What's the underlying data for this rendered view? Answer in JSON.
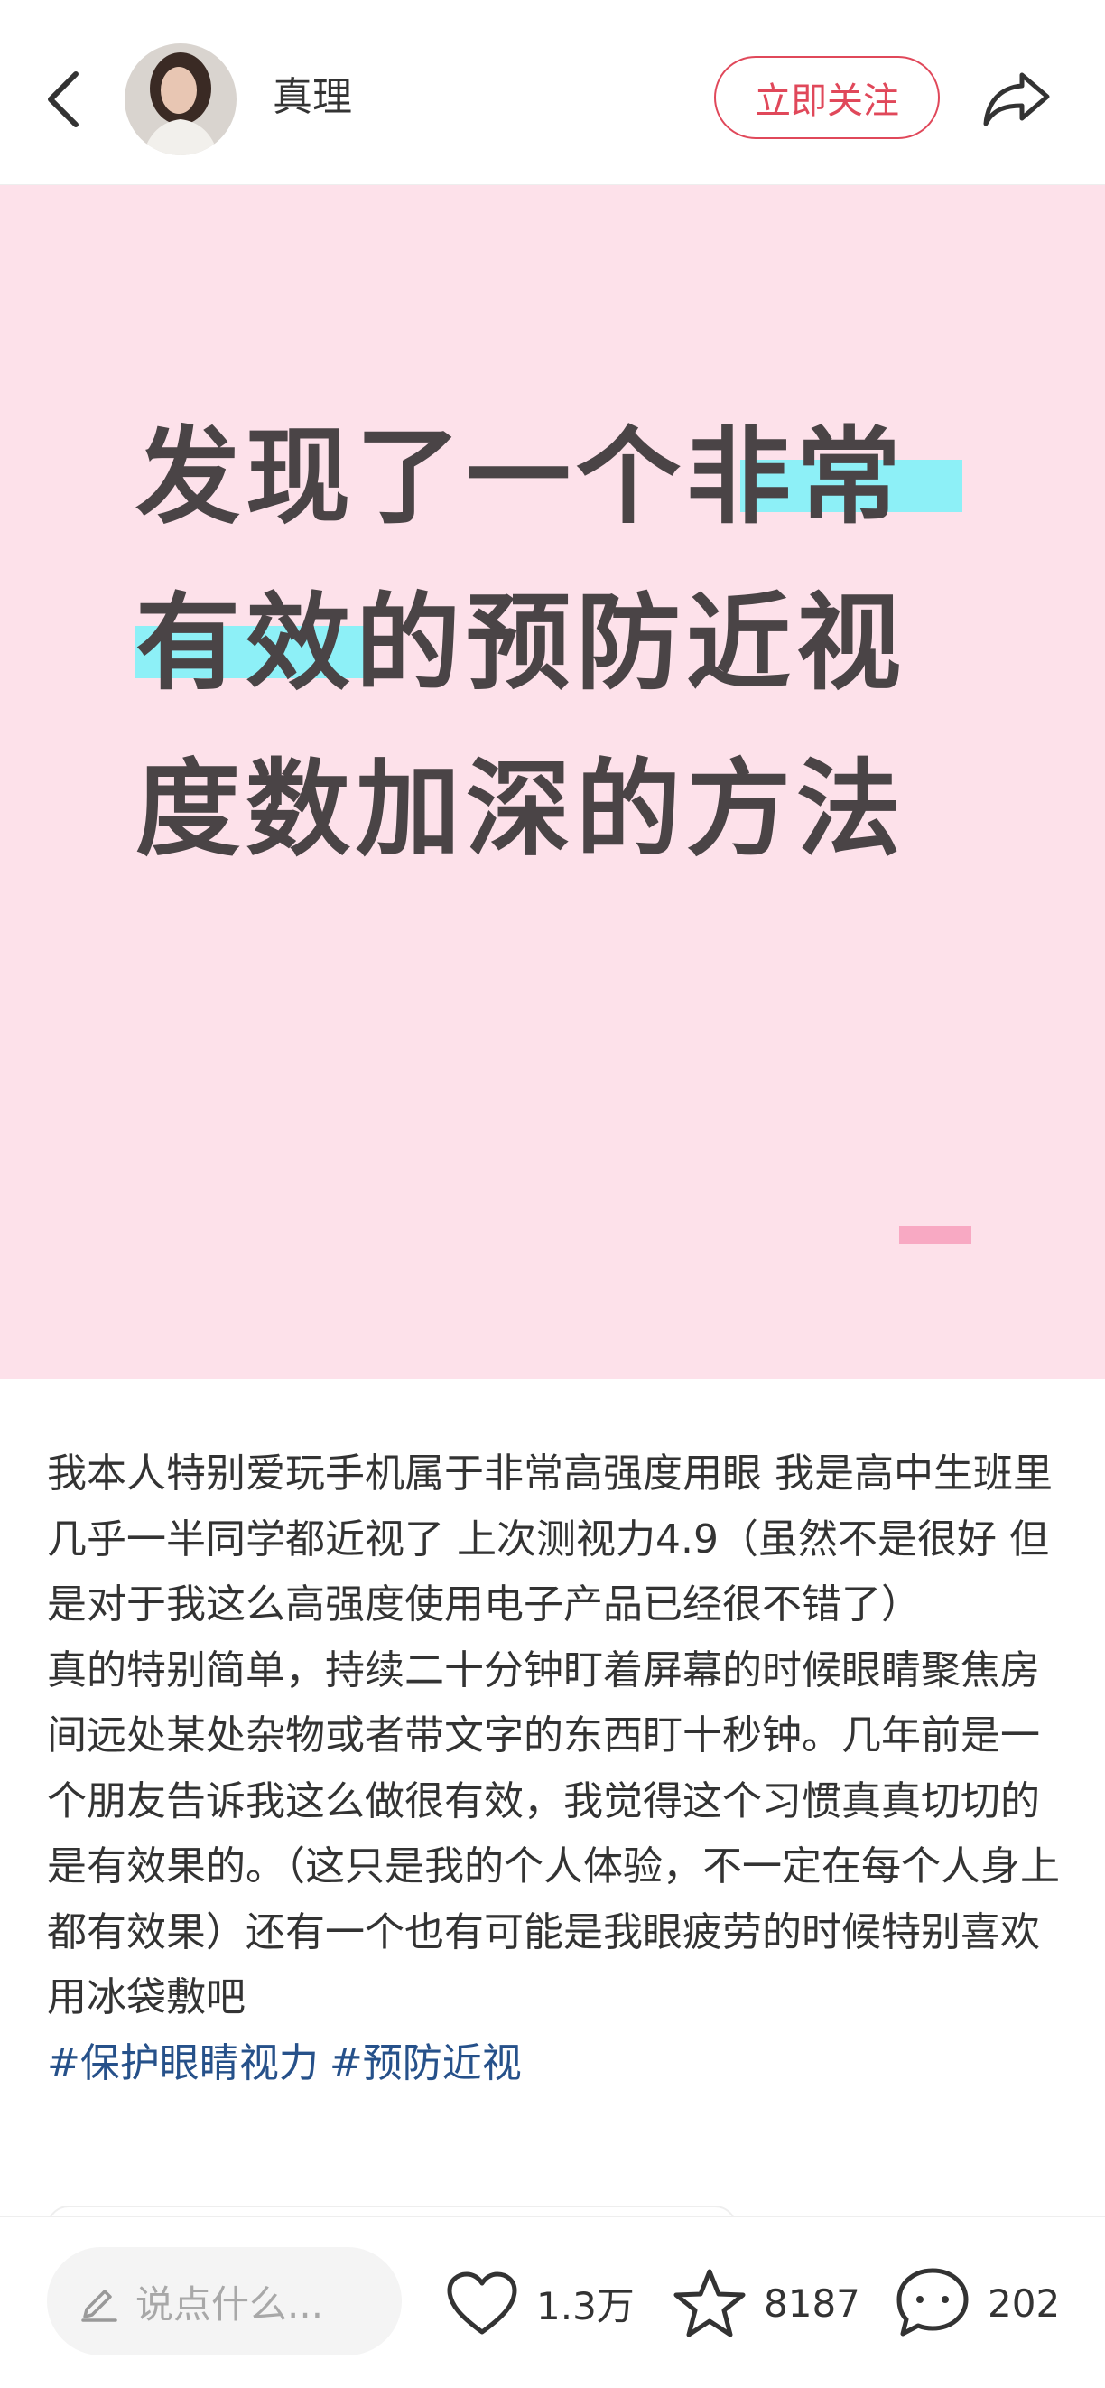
{
  "header": {
    "author_name": "真理",
    "follow_label": "立即关注",
    "back_icon": "back-arrow-icon",
    "share_icon": "share-icon"
  },
  "cover": {
    "title_lines": [
      "发现了一个非常",
      "有效的预防近视",
      "度数加深的方法"
    ],
    "background_color": "#fde1ea",
    "highlight_color": "#8df0f7",
    "text_color": "#4a4446"
  },
  "post": {
    "paragraphs": [
      "我本人特别爱玩手机属于非常高强度用眼 我是高中生班里几乎一半同学都近视了 上次测视力4.9（虽然不是很好 但是对于我这么高强度使用电子产品已经很不错了）",
      "真的特别简单，持续二十分钟盯着屏幕的时候眼睛聚焦房间远处某处杂物或者带文字的东西盯十秒钟。几年前是一个朋友告诉我这么做很有效，我觉得这个习惯真真切切的是有效果的。（这只是我的个人体验，不一定在每个人身上都有效果）还有一个也有可能是我眼疲劳的时候特别喜欢用冰袋敷吧"
    ],
    "tags": [
      "#保护眼睛视力",
      "#预防近视"
    ],
    "tag_color": "#26518a"
  },
  "bottom_bar": {
    "comment_placeholder": "说点什么...",
    "likes": "1.3万",
    "favorites": "8187",
    "comments": "202"
  },
  "colors": {
    "accent": "#e0485a"
  }
}
